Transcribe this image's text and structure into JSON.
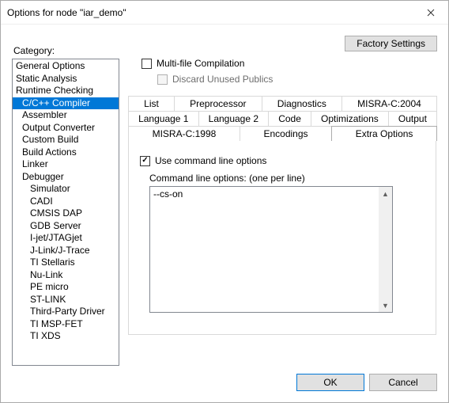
{
  "window": {
    "title": "Options for node \"iar_demo\""
  },
  "category": {
    "label": "Category:",
    "items": [
      {
        "label": "General Options",
        "indent": 0
      },
      {
        "label": "Static Analysis",
        "indent": 0
      },
      {
        "label": "Runtime Checking",
        "indent": 0
      },
      {
        "label": "C/C++ Compiler",
        "indent": 1,
        "selected": true
      },
      {
        "label": "Assembler",
        "indent": 1
      },
      {
        "label": "Output Converter",
        "indent": 1
      },
      {
        "label": "Custom Build",
        "indent": 1
      },
      {
        "label": "Build Actions",
        "indent": 1
      },
      {
        "label": "Linker",
        "indent": 1
      },
      {
        "label": "Debugger",
        "indent": 1
      },
      {
        "label": "Simulator",
        "indent": 2
      },
      {
        "label": "CADI",
        "indent": 2
      },
      {
        "label": "CMSIS DAP",
        "indent": 2
      },
      {
        "label": "GDB Server",
        "indent": 2
      },
      {
        "label": "I-jet/JTAGjet",
        "indent": 2
      },
      {
        "label": "J-Link/J-Trace",
        "indent": 2
      },
      {
        "label": "TI Stellaris",
        "indent": 2
      },
      {
        "label": "Nu-Link",
        "indent": 2
      },
      {
        "label": "PE micro",
        "indent": 2
      },
      {
        "label": "ST-LINK",
        "indent": 2
      },
      {
        "label": "Third-Party Driver",
        "indent": 2
      },
      {
        "label": "TI MSP-FET",
        "indent": 2
      },
      {
        "label": "TI XDS",
        "indent": 2
      }
    ]
  },
  "factory_button": "Factory Settings",
  "compilation": {
    "multi_label": "Multi-file Compilation",
    "discard_label": "Discard Unused Publics"
  },
  "tabs": {
    "row1": [
      "List",
      "Preprocessor",
      "Diagnostics",
      "MISRA-C:2004"
    ],
    "row2": [
      "Language 1",
      "Language 2",
      "Code",
      "Optimizations",
      "Output"
    ],
    "row3": [
      "MISRA-C:1998",
      "Encodings",
      "Extra Options"
    ],
    "active": "Extra Options"
  },
  "extra_options": {
    "use_cmd_label": "Use command line options",
    "cmd_label": "Command line options:  (one per line)",
    "cmd_value": "--cs-on"
  },
  "footer": {
    "ok": "OK",
    "cancel": "Cancel"
  }
}
